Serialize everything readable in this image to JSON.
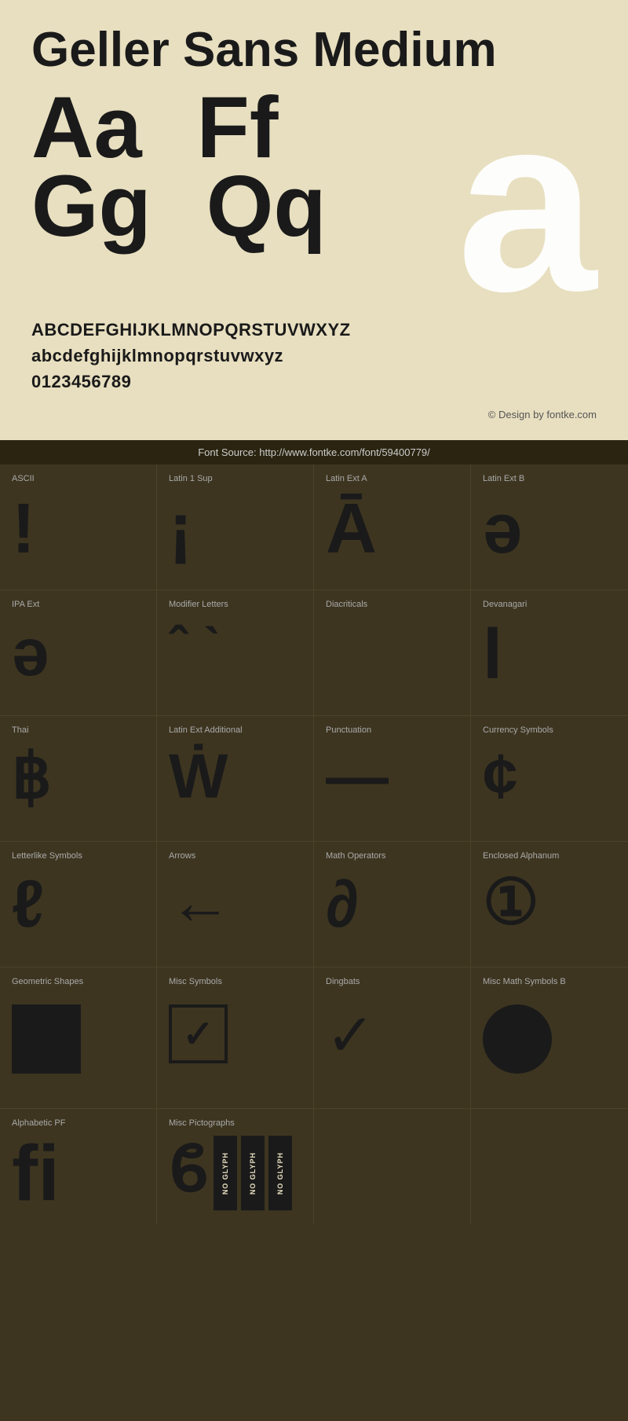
{
  "header": {
    "title": "Geller Sans Medium"
  },
  "specimen": {
    "pairs": [
      "Aa",
      "Ff",
      "Gg",
      "Qq"
    ],
    "big_char": "a",
    "uppercase": "ABCDEFGHIJKLMNOPQRSTUVWXYZ",
    "lowercase": "abcdefghijklmnopqrstuvwxyz",
    "digits": "0123456789",
    "credit": "© Design by fontke.com",
    "font_source": "Font Source: http://www.fontke.com/font/59400779/"
  },
  "glyph_blocks": [
    {
      "label": "ASCII",
      "char": "!",
      "size": "large"
    },
    {
      "label": "Latin 1 Sup",
      "char": "¡",
      "size": "large"
    },
    {
      "label": "Latin Ext A",
      "char": "Ā",
      "size": "large"
    },
    {
      "label": "Latin Ext B",
      "char": "ə",
      "size": "large"
    },
    {
      "label": "IPA Ext",
      "char": "ə",
      "size": "large"
    },
    {
      "label": "Modifier Letters",
      "char": "ˆ`",
      "size": "small"
    },
    {
      "label": "Diacriticals",
      "char": "",
      "size": "large"
    },
    {
      "label": "Devanagari",
      "char": "l",
      "size": "large"
    },
    {
      "label": "Thai",
      "char": "฿",
      "size": "large"
    },
    {
      "label": "Latin Ext Additional",
      "char": "Ẇ",
      "size": "large"
    },
    {
      "label": "Punctuation",
      "char": "—",
      "size": "large"
    },
    {
      "label": "Currency Symbols",
      "char": "¢",
      "size": "large"
    },
    {
      "label": "Letterlike Symbols",
      "char": "ℓ",
      "size": "large"
    },
    {
      "label": "Arrows",
      "char": "←",
      "size": "large"
    },
    {
      "label": "Math Operators",
      "char": "∂",
      "size": "large"
    },
    {
      "label": "Enclosed Alphanum",
      "char": "①",
      "size": "large"
    },
    {
      "label": "Geometric Shapes",
      "char": "■",
      "size": "geo"
    },
    {
      "label": "Misc Symbols",
      "char": "☑",
      "size": "misc"
    },
    {
      "label": "Dingbats",
      "char": "✓",
      "size": "dingbat"
    },
    {
      "label": "Misc Math Symbols B",
      "char": "⬤",
      "size": "circle"
    },
    {
      "label": "Alphabetic PF",
      "char": "ﬁ",
      "size": "ligature"
    },
    {
      "label": "Misc Pictographs",
      "char": "ϐ",
      "size": "pictograph"
    }
  ],
  "no_glyph_label": "NO GLYPH",
  "no_glyph_count": 3
}
